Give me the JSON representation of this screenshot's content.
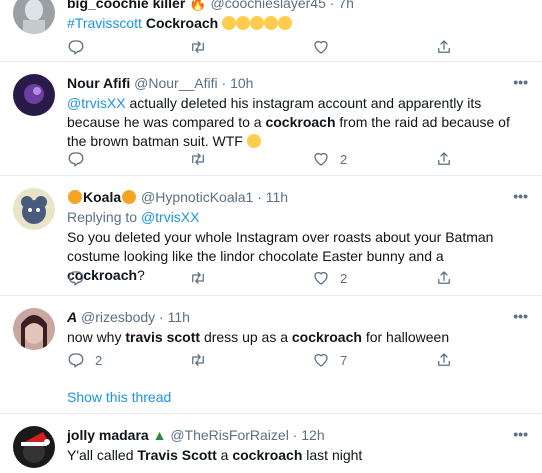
{
  "tweets": [
    {
      "name": "big_coochie killer",
      "handle": "@coochieslayer45",
      "time": "7h",
      "hashtag": "#Travisscott",
      "keyword": "Cockroach",
      "reply_count": "",
      "like_count": ""
    },
    {
      "name": "Nour Afifi",
      "handle": "@Nour__Afifi",
      "time": "10h",
      "mention": "@trvisXX",
      "text_a": " actually deleted his instagram account and apparently its because he was compared to a ",
      "keyword": "cockroach",
      "text_b": " from the raid ad because of the brown batman suit. WTF ",
      "reply_count": "",
      "like_count": "2"
    },
    {
      "name": "Koala",
      "handle": "@HypnoticKoala1",
      "time": "11h",
      "replying_to_label": "Replying to ",
      "replying_to": "@trvisXX",
      "text_a": "So you deleted your whole Instagram over roasts about your Batman costume looking like the lindor chocolate Easter bunny and a ",
      "keyword": "cockroach",
      "text_b": "?",
      "reply_count": "",
      "like_count": "2"
    },
    {
      "name": "A",
      "handle": "@rizesbody",
      "time": "11h",
      "text_a": "now why ",
      "keyword_a": "travis scott",
      "text_b": " dress up as a ",
      "keyword": "cockroach",
      "text_c": " for halloween",
      "reply_count": "2",
      "like_count": "7"
    },
    {
      "name": "jolly madara",
      "handle": "@TheRisForRaizel",
      "time": "12h",
      "text_a": "Y'all called ",
      "keyword_a": "Travis Scott",
      "text_b": " a ",
      "keyword": "cockroach",
      "text_c": " last night"
    }
  ],
  "show_thread": "Show this thread",
  "separator": "·",
  "more_glyph": "•••",
  "colors": {
    "link": "#1b95e0",
    "muted": "#5b7083",
    "divider": "#e6ecf0"
  },
  "icons": [
    "reply-icon",
    "retweet-icon",
    "like-icon",
    "share-icon",
    "more-icon"
  ]
}
